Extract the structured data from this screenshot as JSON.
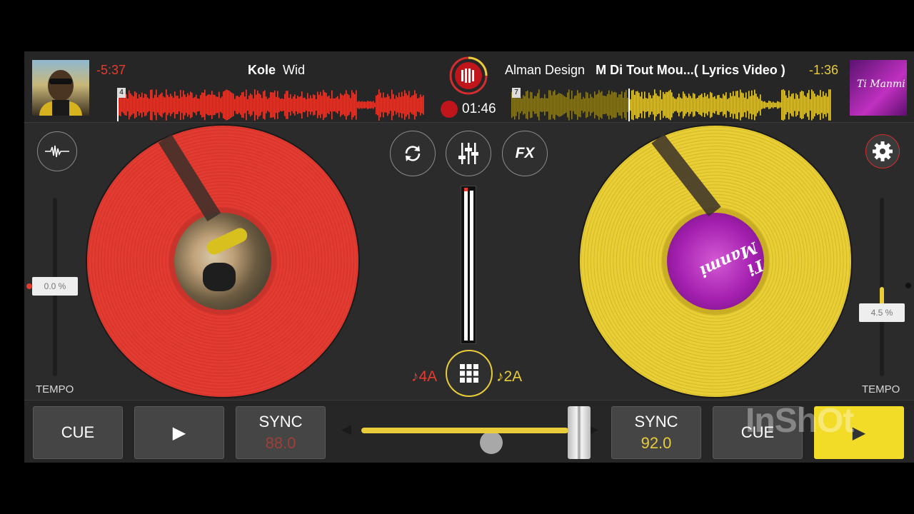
{
  "deck_left": {
    "time_remaining": "-5:37",
    "artist": "Kole",
    "title": "Wid",
    "beat_marker": "4",
    "tempo_value": "0.0 %",
    "tempo_label": "TEMPO",
    "key": "♪4A",
    "cue_label": "CUE",
    "play_icon": "▶",
    "sync_label": "SYNC",
    "bpm": "88.0",
    "color": "#e63b2e"
  },
  "deck_right": {
    "time_remaining": "-1:36",
    "artist": "Alman Design",
    "title": "M Di Tout Mou...( Lyrics Video )",
    "beat_marker": "7",
    "tempo_value": "4.5 %",
    "tempo_label": "TEMPO",
    "key": "♪2A",
    "cue_label": "CUE",
    "play_icon": "▶",
    "sync_label": "SYNC",
    "bpm": "92.0",
    "cover_text": "Ti Manmi",
    "color": "#e8cc3a"
  },
  "recording": {
    "elapsed": "01:46"
  },
  "center": {
    "fx_label": "FX",
    "icons": [
      "waveform-icon",
      "sync-loop-icon",
      "mixer-icon",
      "fx-icon",
      "settings-gear-icon",
      "pads-grid-icon"
    ]
  },
  "watermark": "InShOt"
}
